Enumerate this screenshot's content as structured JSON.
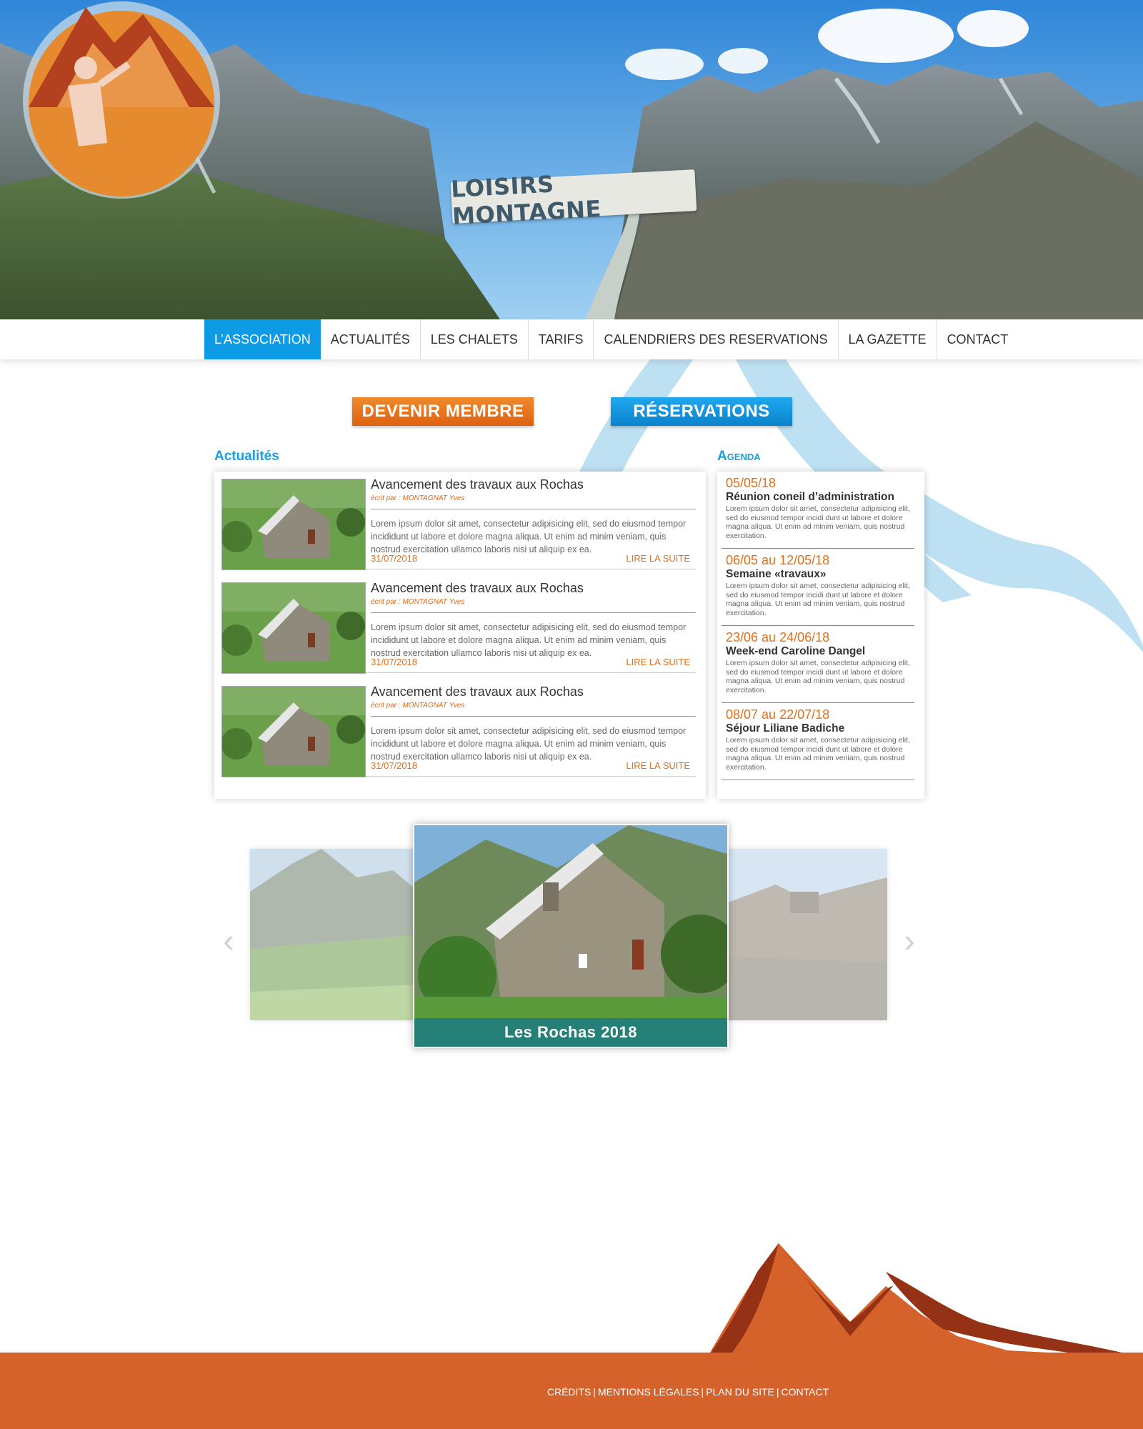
{
  "brand": {
    "logo_text": "LOISIRS MONTAGNE"
  },
  "nav": {
    "items": [
      {
        "label": "L’ASSOCIATION",
        "active": true
      },
      {
        "label": "ACTUALITÉS",
        "active": false
      },
      {
        "label": "LES CHALETS",
        "active": false
      },
      {
        "label": "TARIFS",
        "active": false
      },
      {
        "label": "CALENDRIERS DES RESERVATIONS",
        "active": false
      },
      {
        "label": "LA GAZETTE",
        "active": false
      },
      {
        "label": "CONTACT",
        "active": false
      }
    ]
  },
  "cta": {
    "member": "DEVENIR MEMBRE",
    "reservations": "RÉSERVATIONS"
  },
  "news": {
    "title": "Actualités",
    "items": [
      {
        "title": "Avancement des travaux aux Rochas",
        "author": "écrit par : MONTAGNAT Yves",
        "body": "Lorem ipsum dolor sit amet, consectetur adipisicing elit, sed do eiusmod tempor incididunt ut labore et dolore magna aliqua. Ut enim ad minim veniam, quis nostrud exercitation ullamco laboris nisi ut aliquip ex ea.",
        "date": "31/07/2018",
        "more": "LIRE LA SUITE"
      },
      {
        "title": "Avancement des travaux aux Rochas",
        "author": "écrit par : MONTAGNAT Yves",
        "body": "Lorem ipsum dolor sit amet, consectetur adipisicing elit, sed do eiusmod tempor incididunt ut labore et dolore magna aliqua. Ut enim ad minim veniam, quis nostrud exercitation ullamco laboris nisi ut aliquip ex ea.",
        "date": "31/07/2018",
        "more": "LIRE LA SUITE"
      },
      {
        "title": "Avancement des travaux aux Rochas",
        "author": "écrit par : MONTAGNAT Yves",
        "body": "Lorem ipsum dolor sit amet, consectetur adipisicing elit, sed do eiusmod tempor incididunt ut labore et dolore magna aliqua. Ut enim ad minim veniam, quis nostrud exercitation ullamco laboris nisi ut aliquip ex ea.",
        "date": "31/07/2018",
        "more": "LIRE LA SUITE"
      }
    ]
  },
  "agenda": {
    "title": "Agenda",
    "items": [
      {
        "date": "05/05/18",
        "title": "Réunion coneil d’administration",
        "body": "Lorem ipsum dolor sit amet, consectetur adipisicing elit, sed do eiusmod tempor incidi dunt ut labore et dolore magna aliqua. Ut enim ad minim veniam, quis nostrud exercitation."
      },
      {
        "date": "06/05 au 12/05/18",
        "title": "Semaine «travaux»",
        "body": "Lorem ipsum dolor sit amet, consectetur adipisicing elit, sed do eiusmod tempor incidi dunt ut labore et dolore magna aliqua. Ut enim ad minim veniam, quis nostrud exercitation."
      },
      {
        "date": "23/06 au 24/06/18",
        "title": "Week-end Caroline Dangel",
        "body": "Lorem ipsum dolor sit amet, consectetur adipisicing elit, sed do eiusmod tempor incidi dunt ut labore et dolore magna aliqua. Ut enim ad minim veniam, quis nostrud exercitation."
      },
      {
        "date": "08/07 au 22/07/18",
        "title": "Séjour Liliane Badiche",
        "body": "Lorem ipsum dolor sit amet, consectetur adipisicing elit, sed do eiusmod tempor incidi dunt ut labore et dolore magna aliqua. Ut enim ad minim veniam, quis nostrud exercitation."
      }
    ]
  },
  "carousel": {
    "caption": "Les Rochas 2018",
    "prev_icon": "chevron-left-icon",
    "next_icon": "chevron-right-icon"
  },
  "footer": {
    "links": [
      "CRÉDITS",
      "MENTIONS LÉGALES",
      "PLAN DU SITE",
      "CONTACT"
    ],
    "separator": "|"
  },
  "colors": {
    "accent_blue": "#0e9be6",
    "accent_orange": "#e0701c",
    "footer": "#d5622b"
  }
}
